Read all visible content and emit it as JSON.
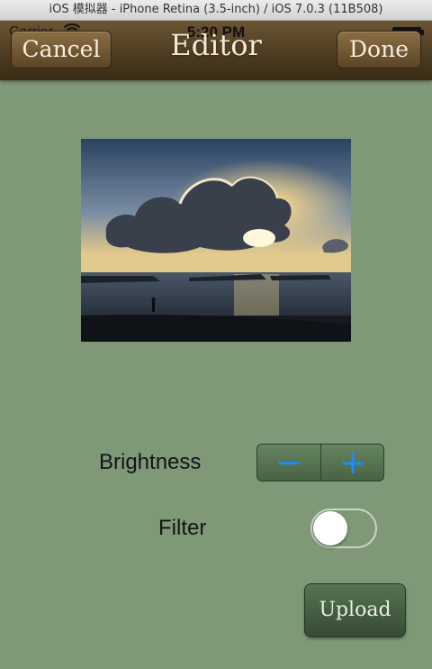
{
  "window": {
    "title": "iOS 模拟器 - iPhone Retina (3.5-inch) / iOS 7.0.3 (11B508)"
  },
  "status_bar": {
    "carrier": "Carrier",
    "time": "5:20 PM"
  },
  "nav": {
    "title": "Editor",
    "cancel_label": "Cancel",
    "done_label": "Done"
  },
  "photo": {
    "subject": "sunset over ocean beach with clouds"
  },
  "controls": {
    "brightness_label": "Brightness",
    "minus_symbol": "−",
    "plus_symbol": "+",
    "filter_label": "Filter",
    "filter_on": false,
    "upload_label": "Upload"
  },
  "colors": {
    "background": "#7e9878",
    "navbar": "#4b3a20",
    "stepper_accent": "#1a8cff"
  }
}
